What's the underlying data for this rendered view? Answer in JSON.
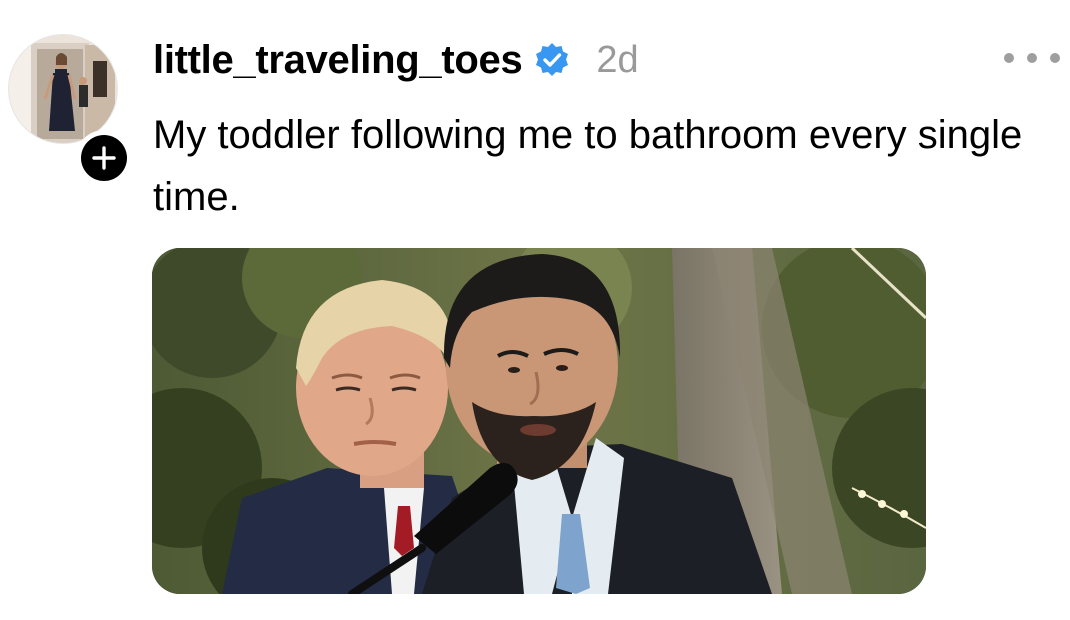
{
  "post": {
    "username": "little_traveling_toes",
    "timestamp": "2d",
    "caption": "My toddler following me to bathroom every single time.",
    "verified": true
  },
  "icons": {
    "verified": "verified-badge-icon",
    "follow": "plus-icon",
    "more": "more-horizontal-icon"
  },
  "colors": {
    "verified_blue": "#3897f0",
    "timestamp_gray": "#999999",
    "more_gray": "#9e9e9e"
  }
}
